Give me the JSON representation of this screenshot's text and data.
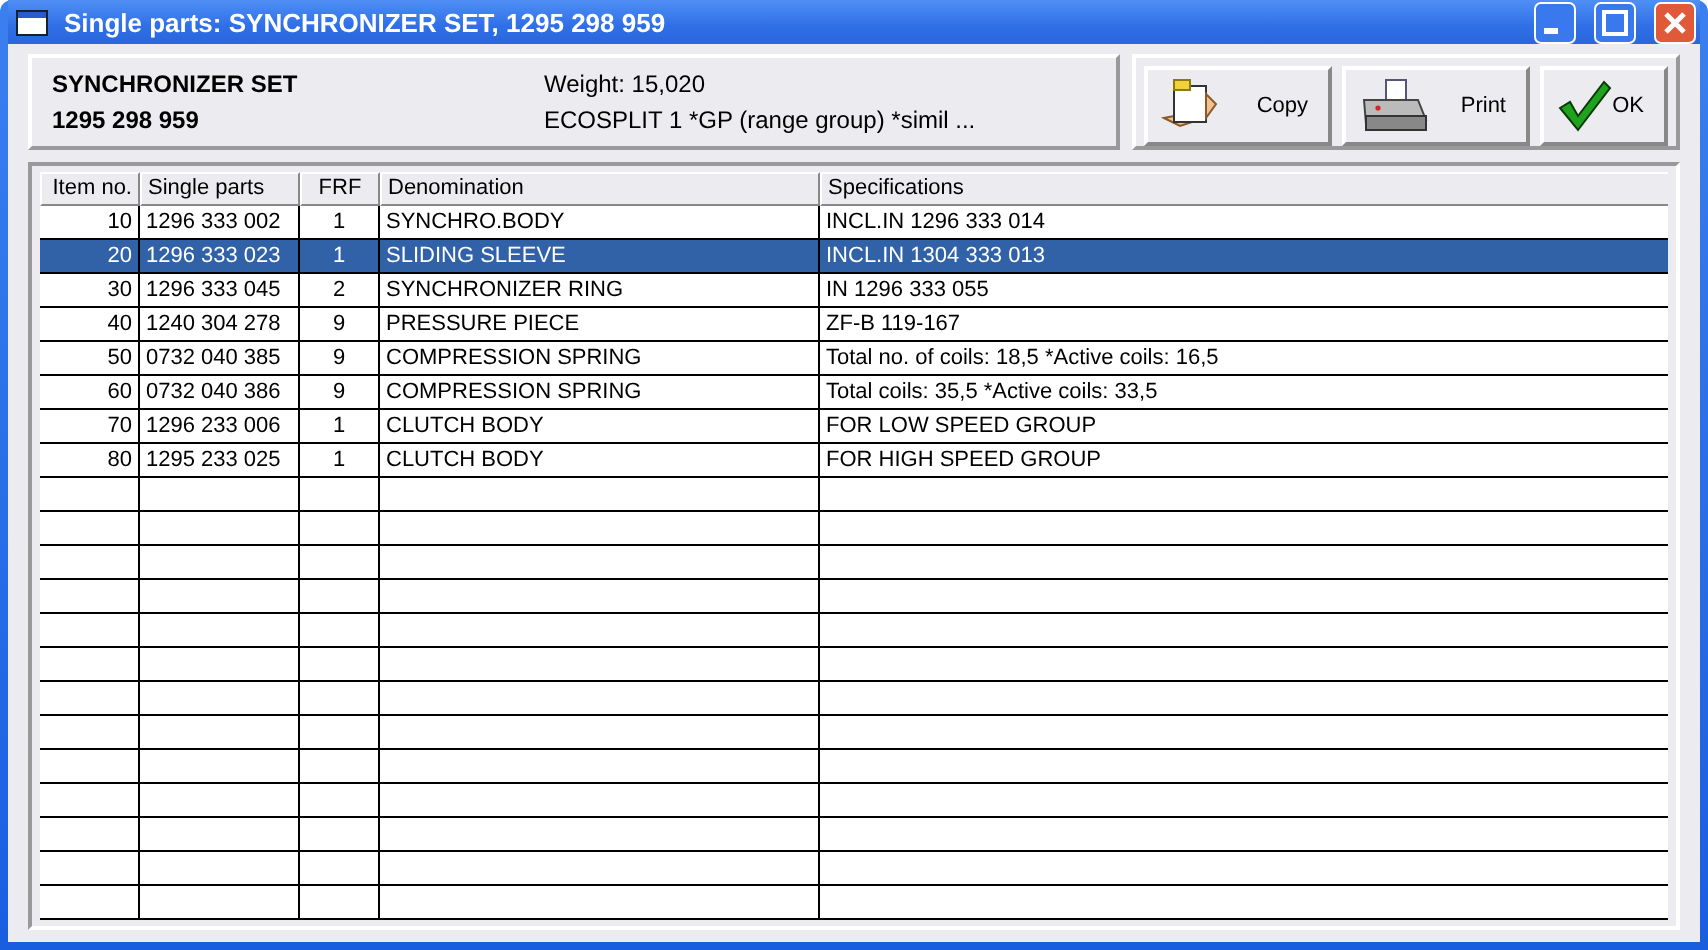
{
  "window": {
    "title": "Single parts: SYNCHRONIZER SET, 1295 298 959"
  },
  "header": {
    "name": "SYNCHRONIZER SET",
    "number": "1295 298 959",
    "weight": "Weight: 15,020",
    "description": "ECOSPLIT 1 *GP (range group) *simil ..."
  },
  "buttons": [
    {
      "kind": "copy",
      "label": "Copy"
    },
    {
      "kind": "print",
      "label": "Print"
    },
    {
      "kind": "ok",
      "label": "OK"
    }
  ],
  "table": {
    "columns": [
      "Item no.",
      "Single parts",
      "FRF",
      "Denomination",
      "Specifications"
    ],
    "rows": [
      {
        "selected": false,
        "cells": [
          "10",
          "1296 333 002",
          "1",
          "SYNCHRO.BODY",
          "INCL.IN 1296 333 014"
        ]
      },
      {
        "selected": true,
        "cells": [
          "20",
          "1296 333 023",
          "1",
          "SLIDING SLEEVE",
          "INCL.IN 1304 333 013"
        ]
      },
      {
        "selected": false,
        "cells": [
          "30",
          "1296 333 045",
          "2",
          "SYNCHRONIZER RING",
          "IN 1296 333 055"
        ]
      },
      {
        "selected": false,
        "cells": [
          "40",
          "1240 304 278",
          "9",
          "PRESSURE PIECE",
          "ZF-B 119-167"
        ]
      },
      {
        "selected": false,
        "cells": [
          "50",
          "0732 040 385",
          "9",
          "COMPRESSION SPRING",
          "Total no. of coils: 18,5 *Active coils: 16,5"
        ]
      },
      {
        "selected": false,
        "cells": [
          "60",
          "0732 040 386",
          "9",
          "COMPRESSION SPRING",
          "Total coils: 35,5 *Active coils: 33,5"
        ]
      },
      {
        "selected": false,
        "cells": [
          "70",
          "1296 233 006",
          "1",
          "CLUTCH BODY",
          "FOR LOW SPEED GROUP"
        ]
      },
      {
        "selected": false,
        "cells": [
          "80",
          "1295 233 025",
          "1",
          "CLUTCH BODY",
          "FOR HIGH SPEED GROUP"
        ]
      }
    ]
  }
}
